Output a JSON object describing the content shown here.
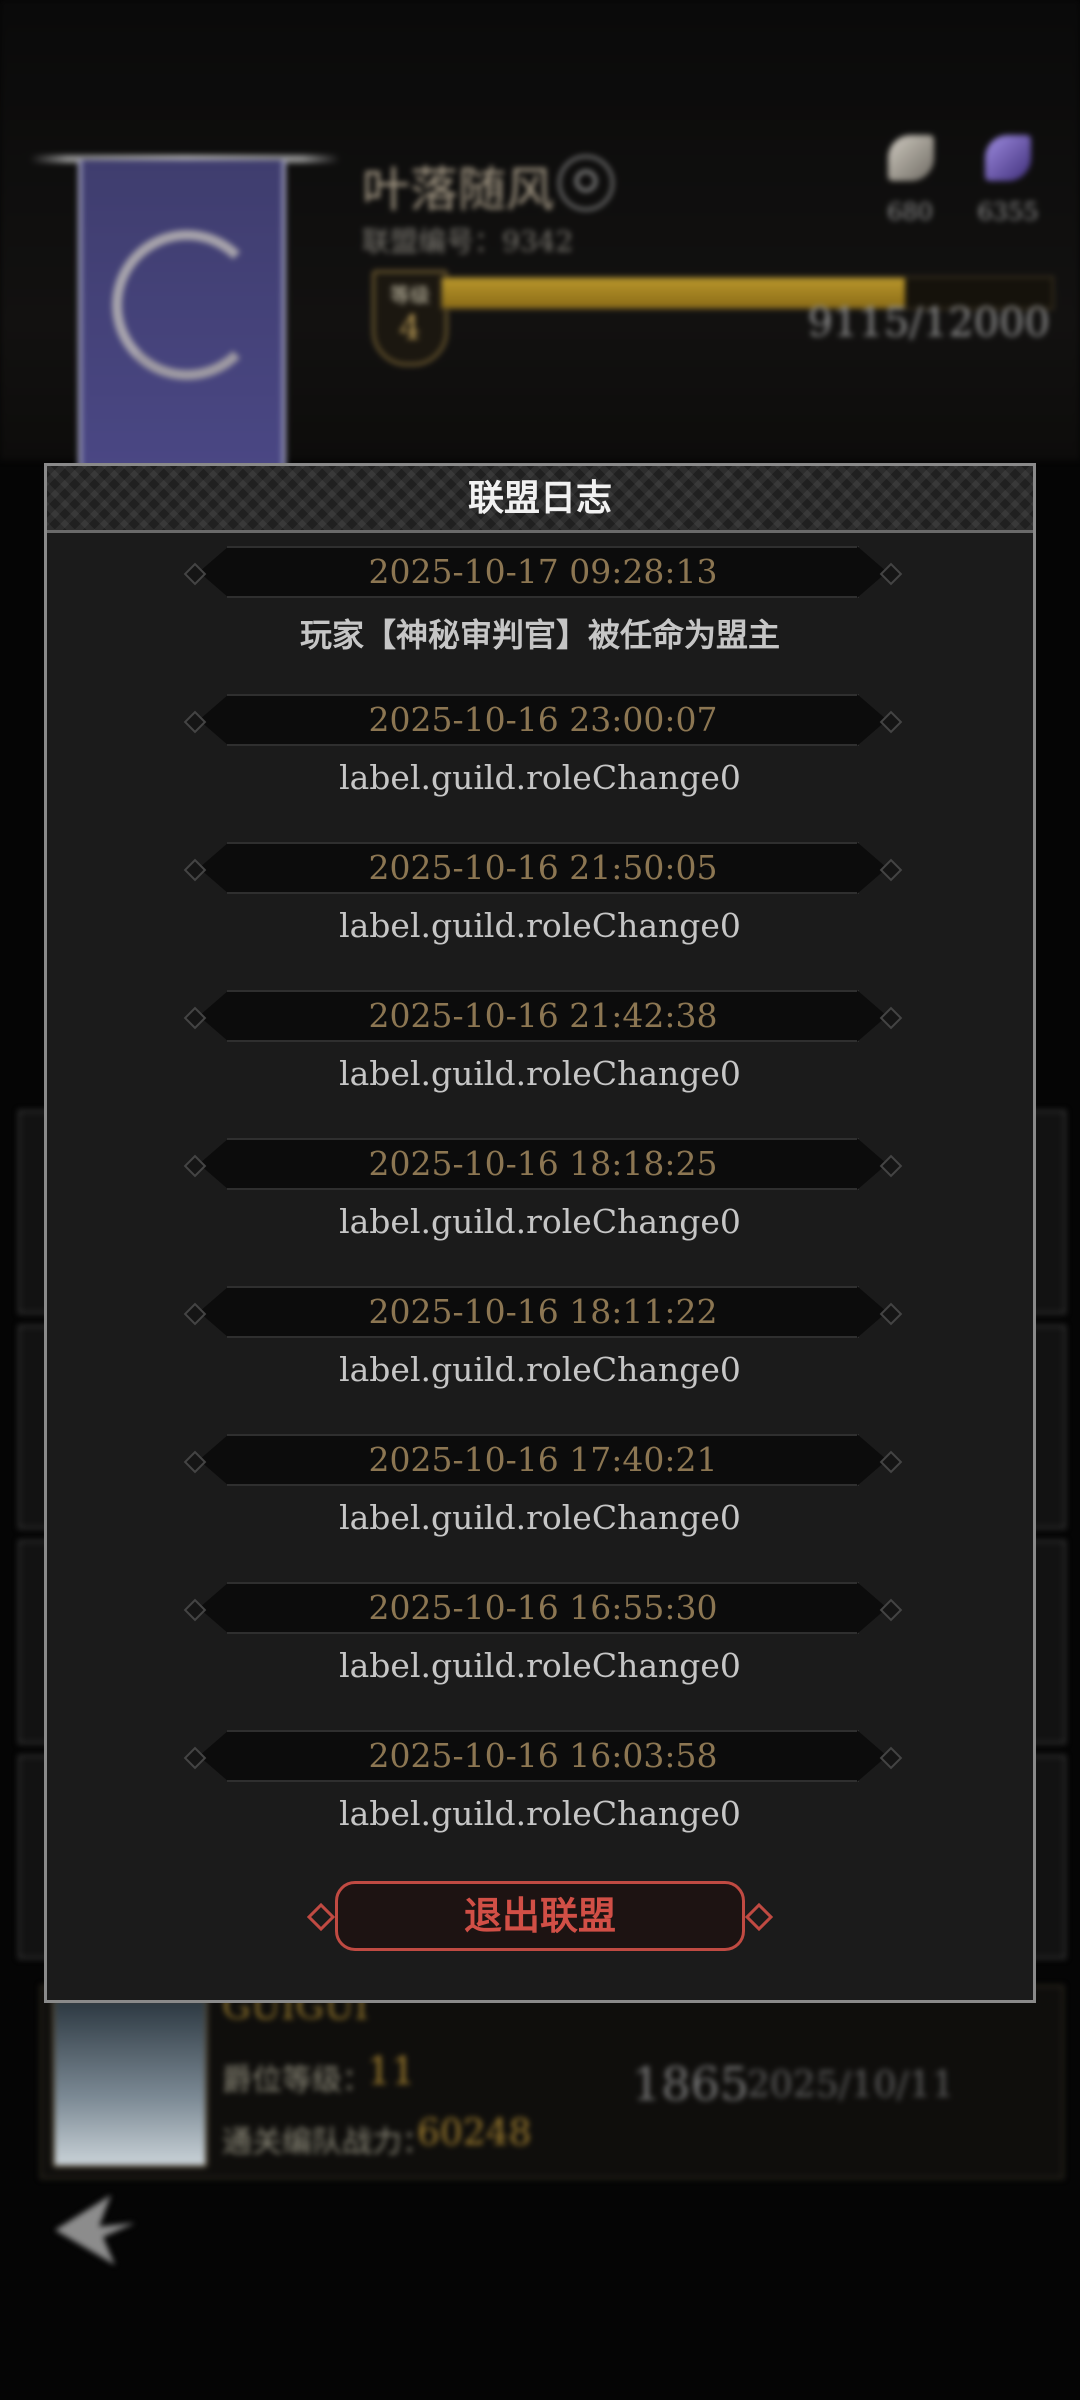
{
  "background": {
    "guild_name": "叶落随风",
    "guild_id": "联盟编号：9342",
    "level_label": "等级",
    "level": "4",
    "xp_text": "9115/12000",
    "xp_progress": 0.7596,
    "resource_1_value": "680",
    "resource_2_value": "6355",
    "member": {
      "name": "GUIGUI",
      "level_label": "爵位等级：",
      "level": "11",
      "power_label": "通关编队战力：",
      "power": "60248",
      "rank": "1865",
      "date": "2025/10/11"
    }
  },
  "modal": {
    "title": "联盟日志",
    "entries": [
      {
        "time": "2025-10-17 09:28:13",
        "message": "玩家【神秘审判官】被任命为盟主"
      },
      {
        "time": "2025-10-16 23:00:07",
        "message": "label.guild.roleChange0"
      },
      {
        "time": "2025-10-16 21:50:05",
        "message": "label.guild.roleChange0"
      },
      {
        "time": "2025-10-16 21:42:38",
        "message": "label.guild.roleChange0"
      },
      {
        "time": "2025-10-16 18:18:25",
        "message": "label.guild.roleChange0"
      },
      {
        "time": "2025-10-16 18:11:22",
        "message": "label.guild.roleChange0"
      },
      {
        "time": "2025-10-16 17:40:21",
        "message": "label.guild.roleChange0"
      },
      {
        "time": "2025-10-16 16:55:30",
        "message": "label.guild.roleChange0"
      },
      {
        "time": "2025-10-16 16:03:58",
        "message": "label.guild.roleChange0"
      }
    ],
    "quit_button": "退出联盟"
  },
  "colors": {
    "timestamp": "#8c7652",
    "quit_button": "#d14f46",
    "xp_fill": "#b8962b"
  }
}
